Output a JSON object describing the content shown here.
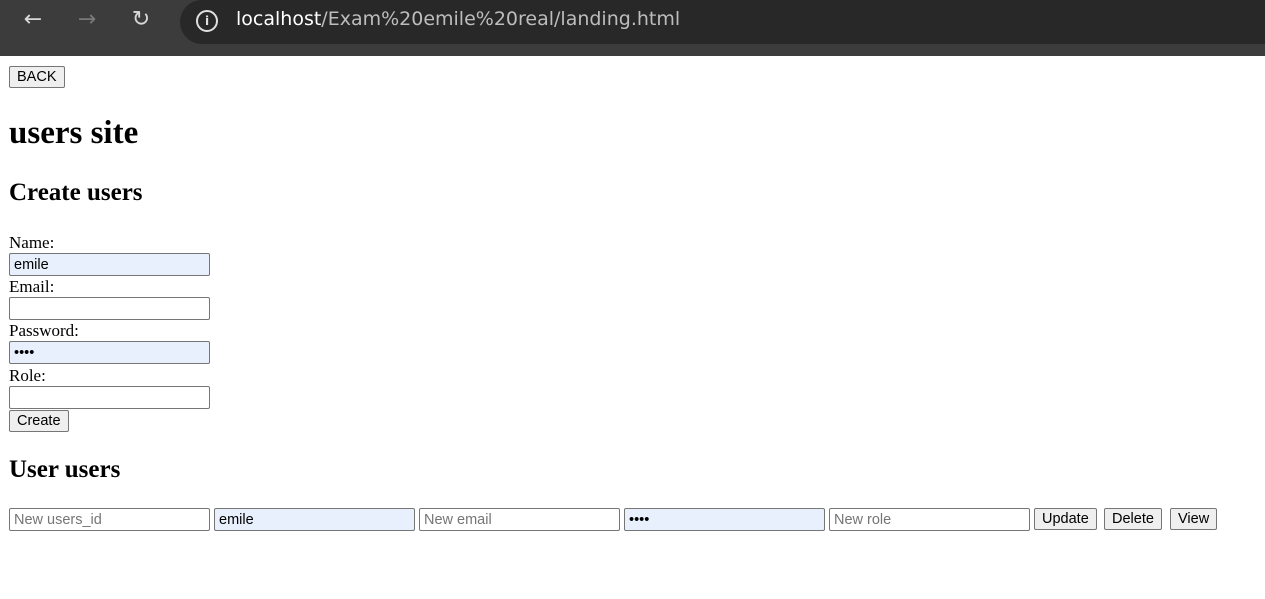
{
  "browser": {
    "url_host": "localhost",
    "url_path": "/Exam%20emile%20real/landing.html",
    "back_icon": "arrow-left-icon",
    "forward_icon": "arrow-right-icon",
    "reload_icon": "reload-icon",
    "site_info_icon": "info-icon"
  },
  "page": {
    "back_label": "BACK",
    "title": "users site",
    "create_section": {
      "heading": "Create users",
      "name_label": "Name:",
      "name_value": "emile",
      "email_label": "Email:",
      "email_value": "",
      "password_label": "Password:",
      "password_value": "emil",
      "role_label": "Role:",
      "role_value": "",
      "create_label": "Create"
    },
    "user_section": {
      "heading": "User users",
      "users_id_placeholder": "New users_id",
      "name_value": "emile",
      "email_placeholder": "New email",
      "password_value": "emil",
      "role_placeholder": "New role",
      "update_label": "Update",
      "delete_label": "Delete",
      "view_label": "View"
    }
  }
}
